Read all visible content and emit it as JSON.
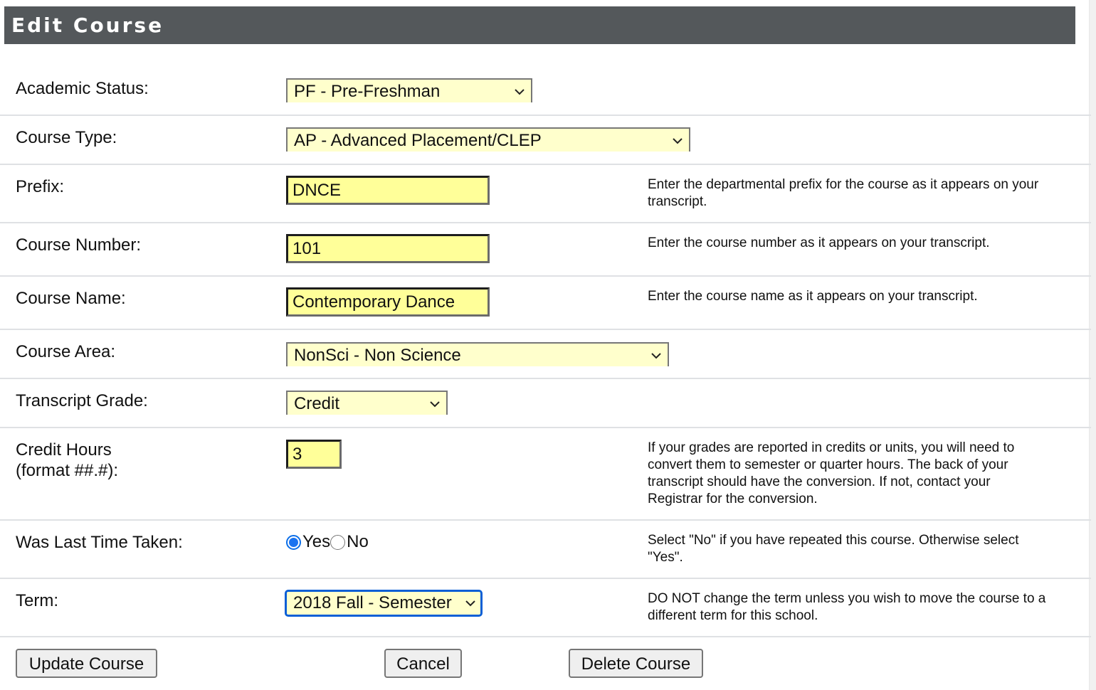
{
  "header": {
    "title": "Edit Course"
  },
  "fields": {
    "academic_status": {
      "label": "Academic Status:",
      "value": "PF - Pre-Freshman"
    },
    "course_type": {
      "label": "Course Type:",
      "value": "AP - Advanced Placement/CLEP"
    },
    "prefix": {
      "label": "Prefix:",
      "value": "DNCE",
      "help": "Enter the departmental prefix for the course as it appears on your transcript."
    },
    "course_number": {
      "label": "Course Number:",
      "value": "101",
      "help": "Enter the course number as it appears on your transcript."
    },
    "course_name": {
      "label": "Course Name:",
      "value": "Contemporary Dance",
      "help": "Enter the course name as it appears on your transcript."
    },
    "course_area": {
      "label": "Course Area:",
      "value": "NonSci - Non Science"
    },
    "transcript_grade": {
      "label": "Transcript Grade:",
      "value": "Credit"
    },
    "credit_hours": {
      "label_line1": "Credit Hours",
      "label_line2": "(format ##.#):",
      "value": "3",
      "help": "If your grades are reported in credits or units, you will need to convert them to semester or quarter hours.  The back of your transcript should have the conversion.  If not, contact your Registrar for the conversion."
    },
    "last_time_taken": {
      "label": "Was Last Time Taken:",
      "options": [
        {
          "label": "Yes",
          "checked": true
        },
        {
          "label": "No",
          "checked": false
        }
      ],
      "help": "Select \"No\" if you have repeated this course. Otherwise select \"Yes\"."
    },
    "term": {
      "label": "Term:",
      "value": "2018 Fall - Semester",
      "help": "DO NOT change the term unless you wish to move the course to a different term for this school."
    }
  },
  "buttons": {
    "update": "Update Course",
    "cancel": "Cancel",
    "delete": "Delete Course"
  },
  "colors": {
    "header_bg": "#54585b",
    "input_bg": "#ffff99",
    "select_bg": "#ffffcc",
    "focus": "#0a5fd6"
  }
}
